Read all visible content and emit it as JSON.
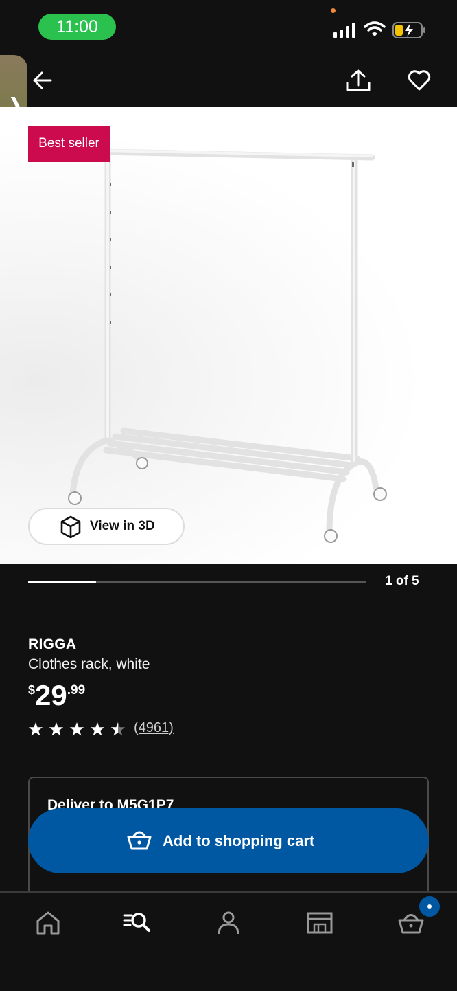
{
  "status_bar": {
    "time": "11:00"
  },
  "header": {
    "back_icon": "arrow-left-icon",
    "share_icon": "share-icon",
    "favorite_icon": "heart-icon"
  },
  "product": {
    "badge": "Best seller",
    "view_3d_label": "View in 3D",
    "gallery_position": "1 of 5",
    "gallery_progress": 0.2,
    "name": "RIGGA",
    "description": "Clothes rack, white",
    "price_currency": "$",
    "price_whole": "29",
    "price_decimal": ".99",
    "rating": 4.5,
    "review_count": "(4961)"
  },
  "delivery": {
    "title": "Deliver to M5G1P7"
  },
  "cart_button": {
    "label": "Add to shopping cart"
  },
  "bottom_nav": {
    "items": [
      "home-icon",
      "search-icon",
      "account-icon",
      "store-icon",
      "cart-icon"
    ]
  },
  "colors": {
    "accent": "#0058a3",
    "badge": "#cc0b4e",
    "background": "#111112"
  }
}
